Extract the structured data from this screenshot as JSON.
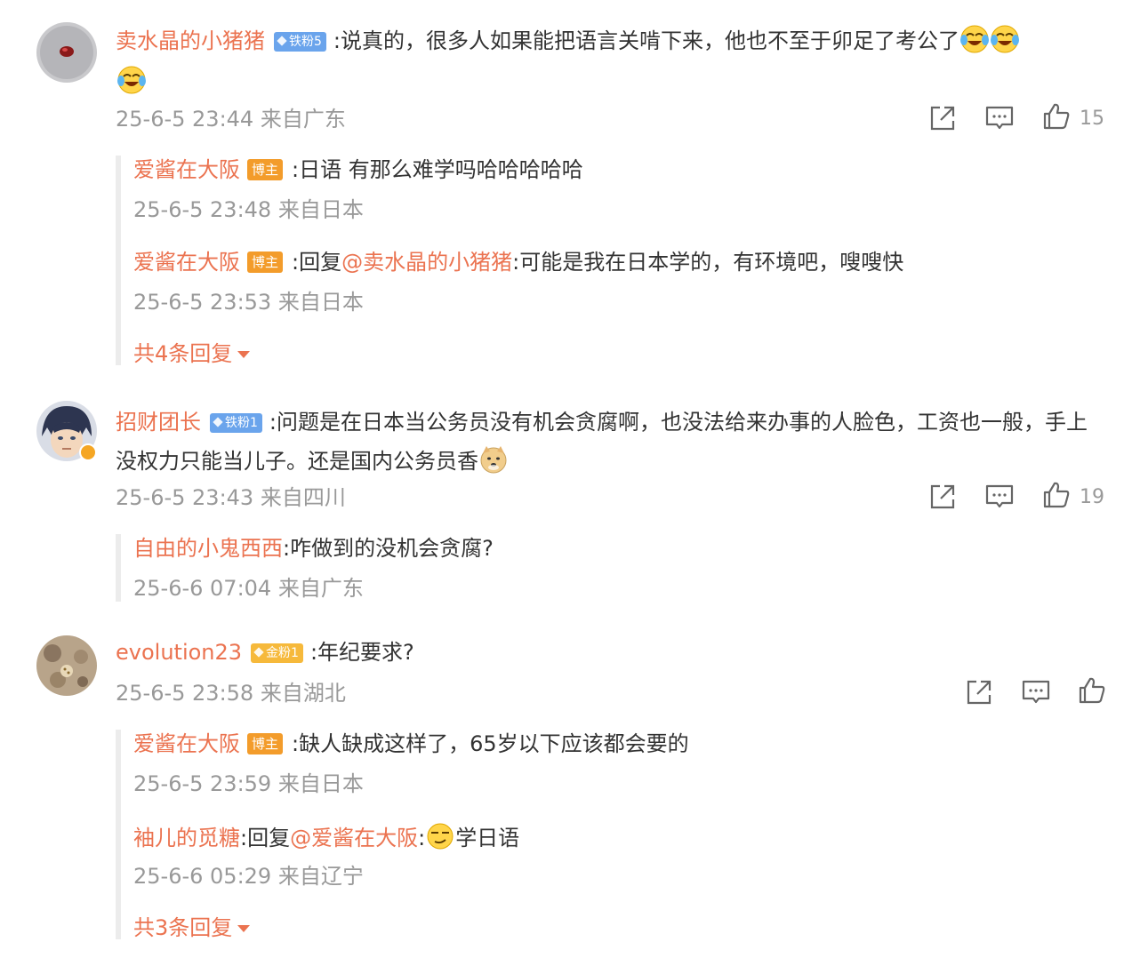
{
  "comments": [
    {
      "username": "卖水晶的小猪猪",
      "fan_badge": "铁粉5",
      "text": ":说真的，很多人如果能把语言关啃下来，他也不至于卯足了考公了",
      "meta": "25-6-5 23:44 来自广东",
      "likes": "15",
      "replies": [
        {
          "username": "爱酱在大阪",
          "badge": "博主",
          "text": ":日语 有那么难学吗哈哈哈哈哈",
          "meta": "25-6-5 23:48 来自日本"
        },
        {
          "username": "爱酱在大阪",
          "badge": "博主",
          "prefix": ":回复",
          "mention": "@卖水晶的小猪猪",
          "text": ":可能是我在日本学的，有环境吧，嗖嗖快",
          "meta": "25-6-5 23:53 来自日本"
        }
      ],
      "more_replies": "共4条回复"
    },
    {
      "username": "招财团长",
      "fan_badge": "铁粉1",
      "text": ":问题是在日本当公务员没有机会贪腐啊，也没法给来办事的人脸色，工资也一般，手上没权力只能当儿子。还是国内公务员香",
      "meta": "25-6-5 23:43 来自四川",
      "likes": "19",
      "replies": [
        {
          "username": "自由的小鬼西西",
          "text": ":咋做到的没机会贪腐?",
          "meta": "25-6-6 07:04 来自广东"
        }
      ]
    },
    {
      "username": "evolution23",
      "fan_badge": "金粉1",
      "text": ":年纪要求?",
      "meta": "25-6-5 23:58 来自湖北",
      "replies": [
        {
          "username": "爱酱在大阪",
          "badge": "博主",
          "text": ":缺人缺成这样了，65岁以下应该都会要的",
          "meta": "25-6-5 23:59 来自日本"
        },
        {
          "username": "袖儿的觅糖",
          "prefix": ":回复",
          "mention": "@爱酱在大阪",
          "colon": ":",
          "text": "学日语",
          "meta": "25-6-6 05:29 来自辽宁"
        }
      ],
      "more_replies": "共3条回复"
    }
  ],
  "icons": [
    "share-icon",
    "comment-icon",
    "like-icon",
    "laughing-crying-emoji",
    "doge-emoji",
    "smirk-emoji",
    "verified-badge-icon"
  ],
  "colors": {
    "username": "#eb7350",
    "meta": "#999999",
    "text": "#333333",
    "fan_badge": "#6aa4ec",
    "gold_badge": "#f6b93b",
    "host_badge": "#f39c2b"
  }
}
